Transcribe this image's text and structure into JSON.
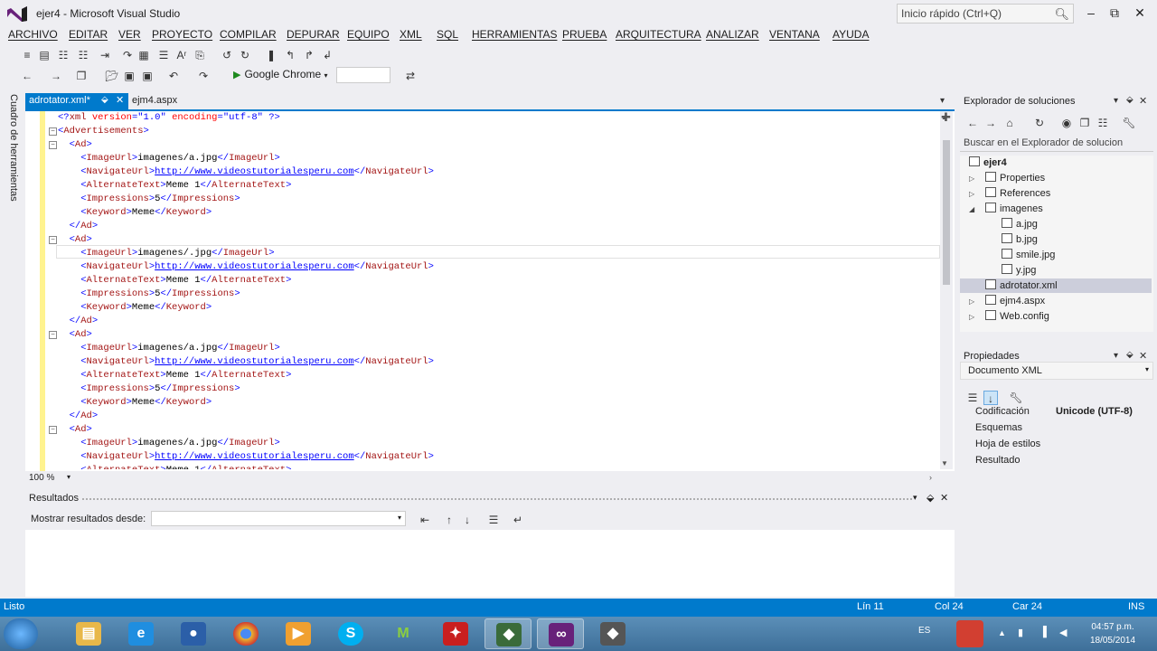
{
  "window": {
    "title": "ejer4 - Microsoft Visual Studio",
    "quick_launch_placeholder": "Inicio rápido (Ctrl+Q)"
  },
  "menu": [
    "ARCHIVO",
    "EDITAR",
    "VER",
    "PROYECTO",
    "COMPILAR",
    "DEPURAR",
    "EQUIPO",
    "XML",
    "SQL",
    "HERRAMIENTAS",
    "PRUEBA",
    "ARQUITECTURA",
    "ANALIZAR",
    "VENTANA",
    "AYUDA"
  ],
  "toolbar": {
    "run_label": "Google Chrome"
  },
  "toolbox": {
    "label": "Cuadro de herramientas"
  },
  "tabs": [
    {
      "label": "adrotator.xml*",
      "active": true
    },
    {
      "label": "ejm4.aspx",
      "active": false
    }
  ],
  "editor": {
    "zoom": "100 %",
    "xml_decl": "<?xml version=\"1.0\" encoding=\"utf-8\" ?>",
    "root_open": "<Advertisements>",
    "ads": [
      {
        "image": "imagenes/a.jpg",
        "url": "http://www.videostutorialesperu.com",
        "alt": "Meme 1",
        "impressions": "5",
        "keyword": "Meme"
      },
      {
        "image": "imagenes/.jpg",
        "url": "http://www.videostutorialesperu.com",
        "alt": "Meme 1",
        "impressions": "5",
        "keyword": "Meme"
      },
      {
        "image": "imagenes/a.jpg",
        "url": "http://www.videostutorialesperu.com",
        "alt": "Meme 1",
        "impressions": "5",
        "keyword": "Meme"
      },
      {
        "image": "imagenes/a.jpg",
        "url": "http://www.videostutorialesperu.com",
        "alt": "Meme 1",
        "impressions": "",
        "keyword": ""
      }
    ]
  },
  "results": {
    "title": "Resultados",
    "show_from_label": "Mostrar resultados desde:"
  },
  "solution_explorer": {
    "title": "Explorador de soluciones",
    "search_placeholder": "Buscar en el Explorador de solucion",
    "items": [
      {
        "label": "ejer4",
        "icon": "project-icon"
      },
      {
        "label": "Properties",
        "icon": "wrench-icon"
      },
      {
        "label": "References",
        "icon": "references-icon"
      },
      {
        "label": "imagenes",
        "icon": "folder-icon"
      },
      {
        "label": "a.jpg",
        "icon": "image-file-icon"
      },
      {
        "label": "b.jpg",
        "icon": "image-file-icon"
      },
      {
        "label": "smile.jpg",
        "icon": "image-file-icon"
      },
      {
        "label": "y.jpg",
        "icon": "image-file-icon"
      },
      {
        "label": "adrotator.xml",
        "icon": "xml-file-icon"
      },
      {
        "label": "ejm4.aspx",
        "icon": "aspx-file-icon"
      },
      {
        "label": "Web.config",
        "icon": "config-file-icon"
      }
    ]
  },
  "properties": {
    "title": "Propiedades",
    "object": "Documento XML",
    "rows": [
      {
        "key": "Codificación",
        "value": "Unicode (UTF-8)"
      },
      {
        "key": "Esquemas",
        "value": ""
      },
      {
        "key": "Hoja de estilos",
        "value": ""
      },
      {
        "key": "Resultado",
        "value": ""
      }
    ]
  },
  "status": {
    "ready": "Listo",
    "line": "Lín 11",
    "col": "Col 24",
    "car": "Car 24",
    "mode": "INS"
  },
  "taskbar": {
    "lang": "ES",
    "time": "04:57 p.m.",
    "date": "18/05/2014"
  },
  "colors": {
    "accent": "#007acc",
    "tag": "#a31515",
    "link": "#0000ff"
  }
}
